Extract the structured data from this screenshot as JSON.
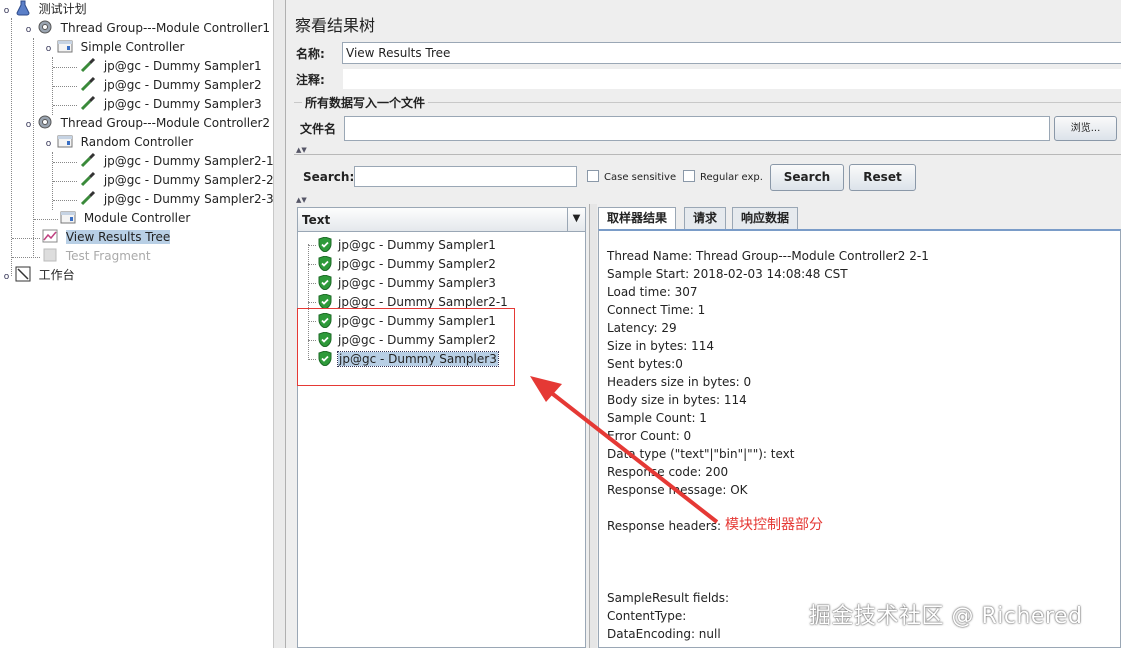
{
  "tree": {
    "root": {
      "label": "测试计划"
    },
    "nodes": [
      {
        "label": "Thread Group---Module Controller1",
        "icon": "gear-icon"
      },
      {
        "label": "Simple Controller",
        "icon": "controller-icon"
      },
      {
        "label": "jp@gc - Dummy Sampler1",
        "icon": "pipette-icon"
      },
      {
        "label": "jp@gc - Dummy Sampler2",
        "icon": "pipette-icon"
      },
      {
        "label": "jp@gc - Dummy Sampler3",
        "icon": "pipette-icon"
      },
      {
        "label": "Thread Group---Module Controller2",
        "icon": "gear-icon"
      },
      {
        "label": "Random Controller",
        "icon": "controller-icon"
      },
      {
        "label": "jp@gc - Dummy Sampler2-1",
        "icon": "pipette-icon"
      },
      {
        "label": "jp@gc - Dummy Sampler2-2",
        "icon": "pipette-icon"
      },
      {
        "label": "jp@gc - Dummy Sampler2-3",
        "icon": "pipette-icon"
      },
      {
        "label": "Module Controller",
        "icon": "controller-icon"
      },
      {
        "label": "View Results Tree",
        "icon": "chart-icon",
        "selected": true
      },
      {
        "label": "Test Fragment",
        "icon": "fragment-icon",
        "disabled": true
      }
    ],
    "workbench": {
      "label": "工作台"
    }
  },
  "panel": {
    "title": "察看结果树",
    "name_label": "名称:",
    "name_value": "View Results Tree",
    "comment_label": "注释:",
    "comment_value": "",
    "file_section_title": "所有数据写入一个文件",
    "filename_label": "文件名",
    "filename_value": "",
    "browse_label": "浏览..."
  },
  "search": {
    "label": "Search:",
    "value": "",
    "case_sensitive_label": "Case sensitive",
    "regex_label": "Regular exp.",
    "search_button": "Search",
    "reset_button": "Reset"
  },
  "results": {
    "renderer_selected": "Text",
    "items": [
      {
        "label": "jp@gc - Dummy Sampler1",
        "status": "success"
      },
      {
        "label": "jp@gc - Dummy Sampler2",
        "status": "success"
      },
      {
        "label": "jp@gc - Dummy Sampler3",
        "status": "success"
      },
      {
        "label": "jp@gc - Dummy Sampler2-1",
        "status": "success"
      },
      {
        "label": "jp@gc - Dummy Sampler1",
        "status": "success"
      },
      {
        "label": "jp@gc - Dummy Sampler2",
        "status": "success"
      },
      {
        "label": "jp@gc - Dummy Sampler3",
        "status": "success",
        "selected": true
      }
    ]
  },
  "detail": {
    "tabs": [
      "取样器结果",
      "请求",
      "响应数据"
    ],
    "active_tab": 0,
    "lines": [
      "Thread Name: Thread Group---Module Controller2 2-1",
      "Sample Start: 2018-02-03 14:08:48 CST",
      "Load time: 307",
      "Connect Time: 1",
      "Latency: 29",
      "Size in bytes: 114",
      "Sent bytes:0",
      "Headers size in bytes: 0",
      "Body size in bytes: 114",
      "Sample Count: 1",
      "Error Count: 0",
      "Data type (\"text\"|\"bin\"|\"\"): text",
      "Response code: 200",
      "Response message: OK",
      "",
      "Response headers:",
      "",
      "",
      "",
      "SampleResult fields:",
      "ContentType:",
      "DataEncoding: null"
    ]
  },
  "annotation": {
    "text": "模块控制器部分",
    "color": "#e53935"
  },
  "watermark": {
    "text": "掘金技术社区 @ Richered"
  }
}
